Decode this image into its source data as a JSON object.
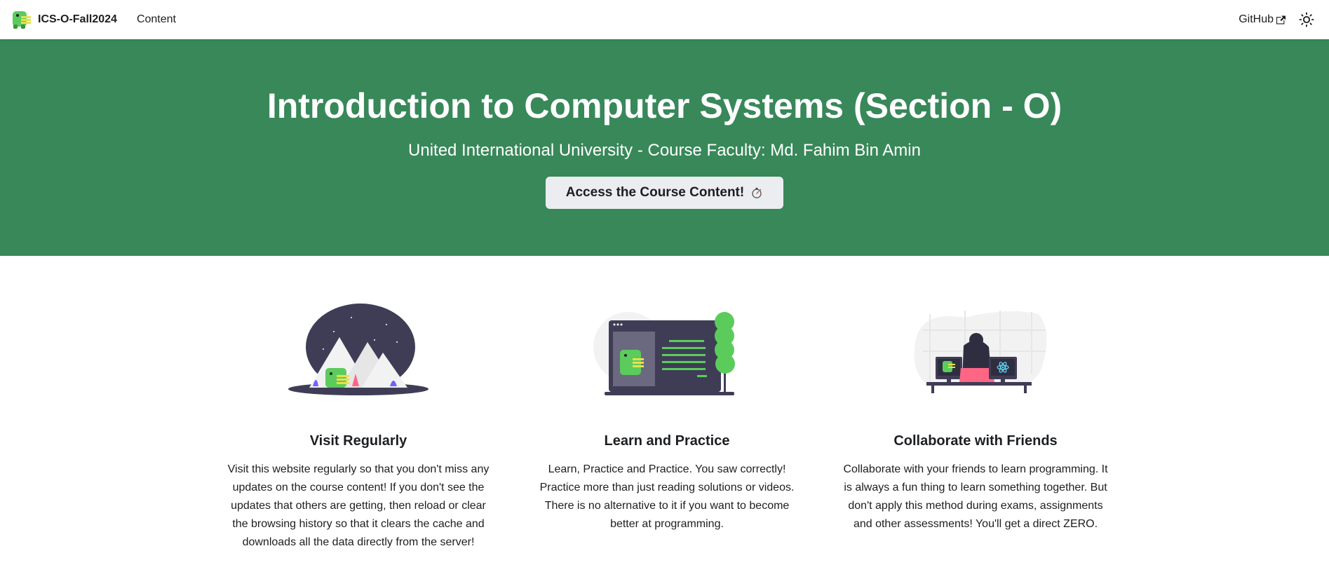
{
  "navbar": {
    "brand_title": "ICS-O-Fall2024",
    "links": [
      {
        "label": "Content"
      }
    ],
    "github_label": "GitHub",
    "icons": {
      "logo": "dino-logo-icon",
      "external": "external-link-icon",
      "theme": "sun-icon"
    }
  },
  "hero": {
    "title": "Introduction to Computer Systems (Section - O)",
    "subtitle": "United International University - Course Faculty: Md. Fahim Bin Amin",
    "button_label": "Access the Course Content!",
    "button_icon": "stopwatch-icon"
  },
  "features": [
    {
      "illustration": "mountain-night-illustration",
      "title": "Visit Regularly",
      "text": "Visit this website regularly so that you don't miss any updates on the course content! If you don't see the updates that others are getting, then reload or clear the browsing history so that it clears the cache and downloads all the data directly from the server!"
    },
    {
      "illustration": "monitor-tree-illustration",
      "title": "Learn and Practice",
      "text": "Learn, Practice and Practice. You saw correctly! Practice more than just reading solutions or videos. There is no alternative to it if you want to become better at programming."
    },
    {
      "illustration": "desk-collaboration-illustration",
      "title": "Collaborate with Friends",
      "text": "Collaborate with your friends to learn programming. It is always a fun thing to learn something together. But don't apply this method during exams, assignments and other assessments! You'll get a direct ZERO."
    }
  ],
  "colors": {
    "hero_bg": "#388859",
    "button_bg": "#ebedf0",
    "dino_green": "#5bcc5b",
    "dark_navy": "#3f3d56"
  }
}
